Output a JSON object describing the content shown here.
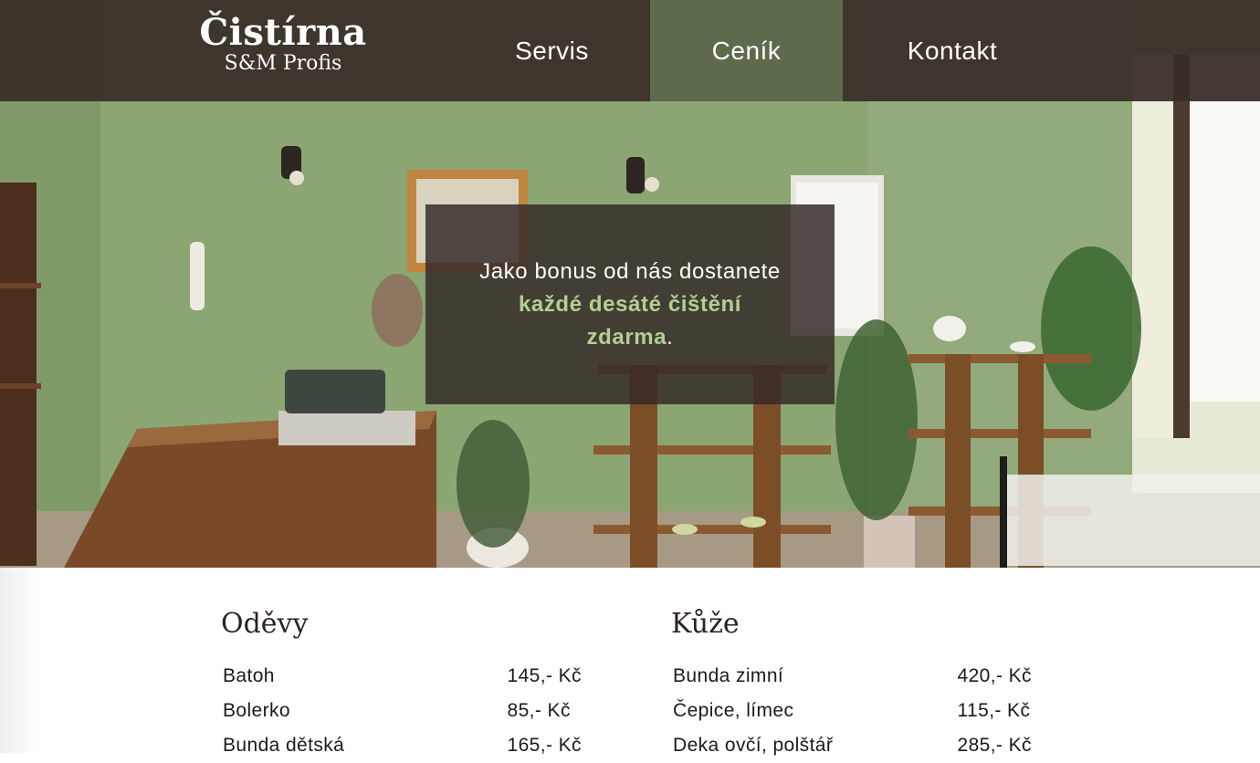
{
  "header": {
    "logo_title": "Čistírna",
    "logo_subtitle": "S&M Profis",
    "nav": [
      {
        "label": "Servis",
        "active": false
      },
      {
        "label": "Ceník",
        "active": true
      },
      {
        "label": "Kontakt",
        "active": false
      }
    ]
  },
  "promo": {
    "text_part1": "Jako bonus od nás dostanete ",
    "text_highlight": "každé desáté čištění zdarma",
    "text_part2": "."
  },
  "price_lists": [
    {
      "heading": "Oděvy",
      "items": [
        {
          "name": "Batoh",
          "price": "145,- Kč"
        },
        {
          "name": "Bolerko",
          "price": "85,- Kč"
        },
        {
          "name": "Bunda dětská",
          "price": "165,- Kč"
        }
      ]
    },
    {
      "heading": "Kůže",
      "items": [
        {
          "name": "Bunda zimní",
          "price": "420,- Kč"
        },
        {
          "name": "Čepice, límec",
          "price": "115,- Kč"
        },
        {
          "name": "Deka ovčí, polštář",
          "price": "285,- Kč"
        }
      ]
    }
  ],
  "colors": {
    "nav_background": "#382c28",
    "nav_active": "#5d6a4c",
    "promo_highlight": "#b5ce93",
    "wall_green": "#8aa374"
  }
}
